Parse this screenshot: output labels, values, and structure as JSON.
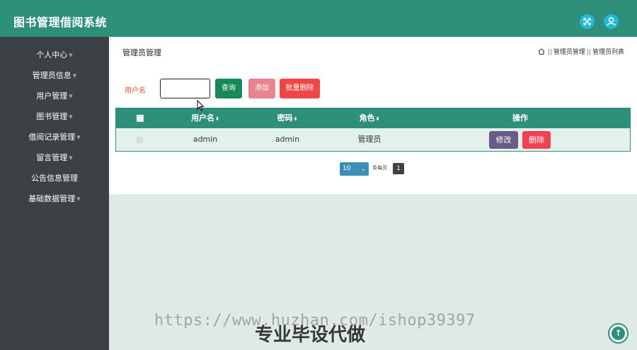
{
  "app": {
    "title": "图书管理借阅系统"
  },
  "header": {
    "icons": [
      "expand-icon",
      "user-icon"
    ],
    "accent": "#2e8f7b"
  },
  "sidebar": {
    "items": [
      {
        "label": "个人中心",
        "has_caret": true
      },
      {
        "label": "管理员信息",
        "has_caret": true
      },
      {
        "label": "用户管理",
        "has_caret": true
      },
      {
        "label": "图书管理",
        "has_caret": true
      },
      {
        "label": "借阅记录管理",
        "has_caret": true
      },
      {
        "label": "留言管理",
        "has_caret": true
      },
      {
        "label": "公告信息管理",
        "has_caret": false
      },
      {
        "label": "基础数据管理",
        "has_caret": true
      }
    ]
  },
  "page": {
    "title": "管理员管理",
    "breadcrumb": [
      "管理员管理",
      "管理员列表"
    ],
    "breadcrumb_sep": "||"
  },
  "search": {
    "label": "用户名",
    "value": ""
  },
  "buttons": {
    "query": "查询",
    "add": "添加",
    "bulk_delete": "批量删除"
  },
  "table": {
    "columns": [
      "用户名",
      "密码",
      "角色",
      "操作"
    ],
    "rows": [
      {
        "username": "admin",
        "password": "admin",
        "role": "管理员",
        "edit": "修改",
        "delete": "删除"
      }
    ]
  },
  "pagination": {
    "page_size": "10",
    "text": "条每页",
    "current_page": "1"
  },
  "watermark": {
    "url": "https://www.huzhan.com/ishop39397",
    "text": "专业毕设代做"
  }
}
